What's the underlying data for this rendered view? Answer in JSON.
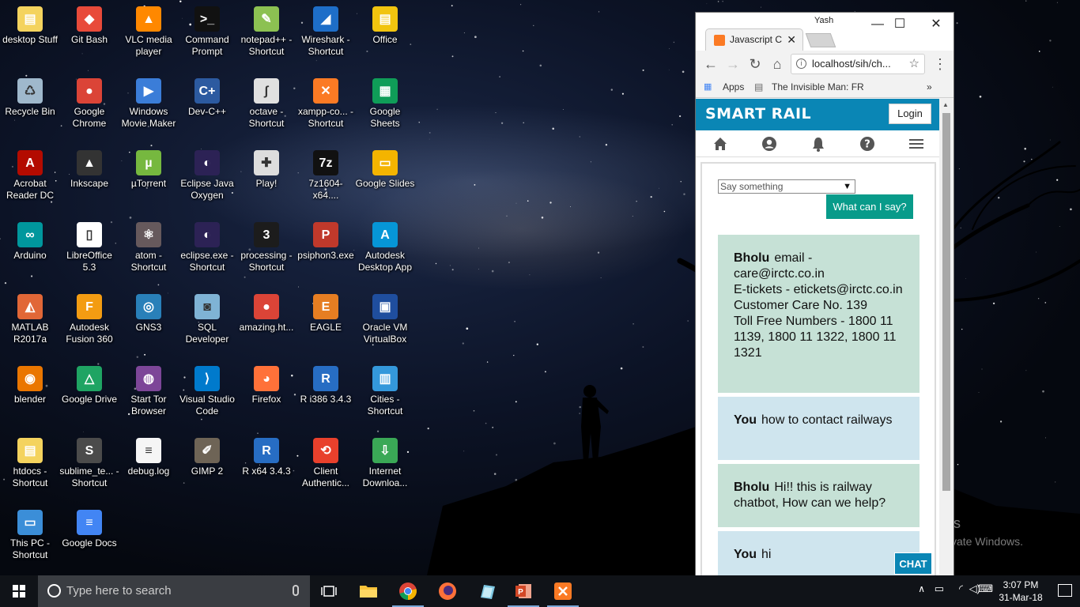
{
  "desktop": {
    "icons": [
      {
        "label": "desktop Stuff",
        "color": "#f4d35e",
        "glyph": "▤"
      },
      {
        "label": "Git Bash",
        "color": "#e84a3a",
        "glyph": "◆"
      },
      {
        "label": "VLC media player",
        "color": "#ff8800",
        "glyph": "▲"
      },
      {
        "label": "Command Prompt",
        "color": "#111111",
        "glyph": ">_"
      },
      {
        "label": "notepad++ - Shortcut",
        "color": "#8cc152",
        "glyph": "✎"
      },
      {
        "label": "Wireshark - Shortcut",
        "color": "#1e6ec8",
        "glyph": "◢"
      },
      {
        "label": "Office",
        "color": "#f1c40f",
        "glyph": "▤"
      },
      {
        "label": "Recycle Bin",
        "color": "#9fb8cc",
        "glyph": "♺"
      },
      {
        "label": "Google Chrome",
        "color": "#db4437",
        "glyph": "●"
      },
      {
        "label": "Windows Movie Maker",
        "color": "#3b7dd8",
        "glyph": "▶"
      },
      {
        "label": "Dev-C++",
        "color": "#2c5aa0",
        "glyph": "C+"
      },
      {
        "label": "octave - Shortcut",
        "color": "#e0e0e0",
        "glyph": "∫"
      },
      {
        "label": "xampp-co... - Shortcut",
        "color": "#fb7a24",
        "glyph": "✕"
      },
      {
        "label": "Google Sheets",
        "color": "#0f9d58",
        "glyph": "▦"
      },
      {
        "label": "Acrobat Reader DC",
        "color": "#b30b00",
        "glyph": "A"
      },
      {
        "label": "Inkscape",
        "color": "#333333",
        "glyph": "▲"
      },
      {
        "label": "µTorrent",
        "color": "#76b83f",
        "glyph": "µ"
      },
      {
        "label": "Eclipse Java Oxygen",
        "color": "#2c2255",
        "glyph": "◐"
      },
      {
        "label": "Play!",
        "color": "#dddddd",
        "glyph": "✚"
      },
      {
        "label": "7z1604-x64....",
        "color": "#111111",
        "glyph": "7z"
      },
      {
        "label": "Google Slides",
        "color": "#f4b400",
        "glyph": "▭"
      },
      {
        "label": "Arduino",
        "color": "#00979d",
        "glyph": "∞"
      },
      {
        "label": "LibreOffice 5.3",
        "color": "#ffffff",
        "glyph": "▯"
      },
      {
        "label": "atom - Shortcut",
        "color": "#66595c",
        "glyph": "⚛"
      },
      {
        "label": "eclipse.exe - Shortcut",
        "color": "#2c2255",
        "glyph": "◐"
      },
      {
        "label": "processing - Shortcut",
        "color": "#1c1c1c",
        "glyph": "3"
      },
      {
        "label": "psiphon3.exe",
        "color": "#c0392b",
        "glyph": "P"
      },
      {
        "label": "Autodesk Desktop App",
        "color": "#0696d7",
        "glyph": "A"
      },
      {
        "label": "MATLAB R2017a",
        "color": "#e16737",
        "glyph": "◭"
      },
      {
        "label": "Autodesk Fusion 360",
        "color": "#f39c12",
        "glyph": "F"
      },
      {
        "label": "GNS3",
        "color": "#2980b9",
        "glyph": "◎"
      },
      {
        "label": "SQL Developer",
        "color": "#7fb3d5",
        "glyph": "◙"
      },
      {
        "label": "amazing.ht...",
        "color": "#db4437",
        "glyph": "●"
      },
      {
        "label": "EAGLE",
        "color": "#e67e22",
        "glyph": "E"
      },
      {
        "label": "Oracle VM VirtualBox",
        "color": "#1f4e9e",
        "glyph": "▣"
      },
      {
        "label": "blender",
        "color": "#ea7600",
        "glyph": "◉"
      },
      {
        "label": "Google Drive",
        "color": "#1fa463",
        "glyph": "△"
      },
      {
        "label": "Start Tor Browser",
        "color": "#7d4698",
        "glyph": "◍"
      },
      {
        "label": "Visual Studio Code",
        "color": "#007acc",
        "glyph": "⟩"
      },
      {
        "label": "Firefox",
        "color": "#ff7139",
        "glyph": "◕"
      },
      {
        "label": "R i386 3.4.3",
        "color": "#276dc3",
        "glyph": "R"
      },
      {
        "label": "Cities - Shortcut",
        "color": "#3498db",
        "glyph": "▥"
      },
      {
        "label": "htdocs - Shortcut",
        "color": "#f4d35e",
        "glyph": "▤"
      },
      {
        "label": "sublime_te... - Shortcut",
        "color": "#4b4b4b",
        "glyph": "S"
      },
      {
        "label": "debug.log",
        "color": "#f5f5f5",
        "glyph": "≡"
      },
      {
        "label": "GIMP 2",
        "color": "#6e6456",
        "glyph": "✐"
      },
      {
        "label": "R x64 3.4.3",
        "color": "#276dc3",
        "glyph": "R"
      },
      {
        "label": "Client Authentic...",
        "color": "#e8402c",
        "glyph": "⟲"
      },
      {
        "label": "Internet Downloa...",
        "color": "#3aa856",
        "glyph": "⇩"
      },
      {
        "label": "This PC - Shortcut",
        "color": "#3b8ed8",
        "glyph": "▭"
      },
      {
        "label": "Google Docs",
        "color": "#4285f4",
        "glyph": "≡"
      }
    ],
    "watermark": {
      "line1": "Activate Windows",
      "line2": "Go to Settings to activate Windows."
    }
  },
  "browser": {
    "user": "Yash",
    "tab_title": "Javascript C",
    "tab_close": "✕",
    "minimize": "—",
    "maximize": "☐",
    "close": "✕",
    "url": "localhost/sih/ch...",
    "bookmarks": {
      "apps": "Apps",
      "item": "The Invisible Man: FR",
      "more": "»"
    }
  },
  "app": {
    "brand": "SMART RAIL",
    "login_label": "Login",
    "nav_icons": [
      "home-icon",
      "user-icon",
      "bell-icon",
      "help-icon",
      "menu-icon"
    ],
    "say_placeholder": "Say something",
    "what_button": "What can I say?",
    "messages": [
      {
        "speaker": "Bholu",
        "lines": [
          "email - care@irctc.co.in",
          "E-tickets - etickets@irctc.co.in",
          "Customer Care No. 139",
          "Toll Free Numbers - 1800 11 1139, 1800 11 1322, 1800 11 1321"
        ]
      },
      {
        "speaker": "You",
        "lines": [
          "how to contact railways"
        ]
      },
      {
        "speaker": "Bholu",
        "lines": [
          "Hi!! this is railway chatbot, How can we help?"
        ]
      },
      {
        "speaker": "You",
        "lines": [
          "hi"
        ]
      }
    ],
    "chat_button": "CHAT",
    "colors": {
      "header": "#0a86b5",
      "bot_bubble": "#c6e1d6",
      "you_bubble": "#cfe5ee",
      "button": "#089b8a"
    }
  },
  "taskbar": {
    "search_placeholder": "Type here to search",
    "pinned": [
      "task-view-icon",
      "file-explorer-icon",
      "chrome-icon",
      "firefox-icon",
      "paint-icon",
      "powerpoint-icon",
      "xampp-icon"
    ],
    "clock_time": "3:07 PM",
    "clock_date": "31-Mar-18"
  }
}
